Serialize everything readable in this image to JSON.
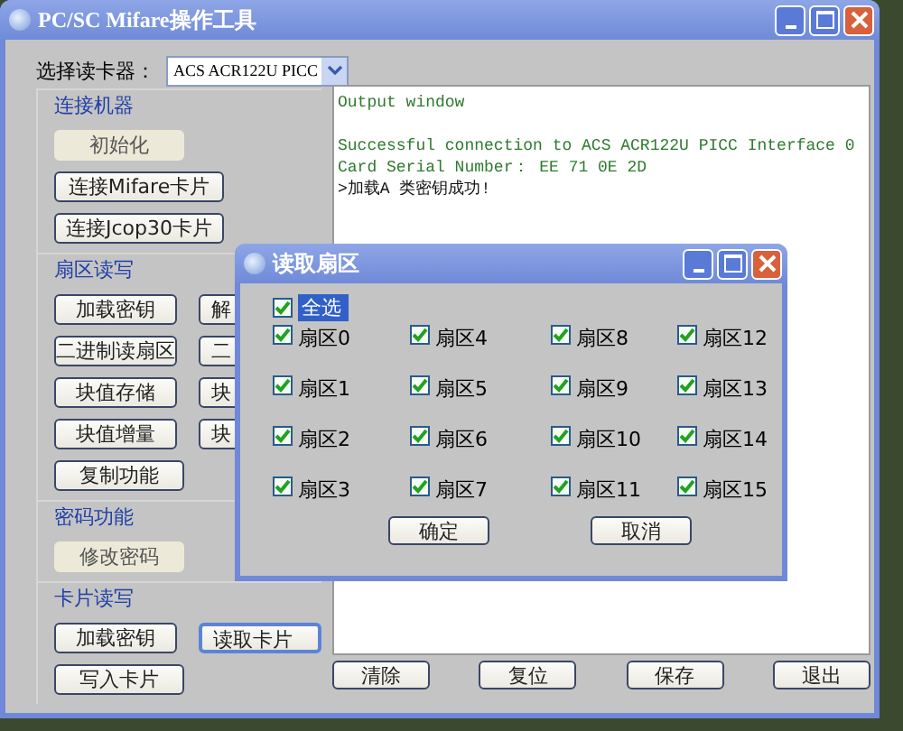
{
  "window": {
    "title": "PC/SC Mifare操作工具"
  },
  "reader": {
    "label": "选择读卡器：",
    "value": "ACS ACR122U PICC"
  },
  "groups": [
    {
      "title": "连接机器",
      "rows": [
        [
          {
            "label": "初始化",
            "disabled": true,
            "focused": false
          }
        ],
        [
          {
            "label": "连接Mifare卡片",
            "disabled": false,
            "focused": false
          }
        ],
        [
          {
            "label": "连接Jcop30卡片",
            "disabled": false,
            "focused": false
          }
        ]
      ]
    },
    {
      "title": "扇区读写",
      "rows": [
        [
          {
            "label": "加载密钥",
            "disabled": false,
            "focused": false
          },
          {
            "label": "解",
            "disabled": false,
            "focused": false
          }
        ],
        [
          {
            "label": "二进制读扇区",
            "disabled": false,
            "focused": false
          },
          {
            "label": "二",
            "disabled": false,
            "focused": false
          }
        ],
        [
          {
            "label": "块值存储",
            "disabled": false,
            "focused": false
          },
          {
            "label": "块",
            "disabled": false,
            "focused": false
          }
        ],
        [
          {
            "label": "块值增量",
            "disabled": false,
            "focused": false
          },
          {
            "label": "块",
            "disabled": false,
            "focused": false
          }
        ],
        [
          {
            "label": "复制功能",
            "disabled": false,
            "focused": false
          }
        ]
      ]
    },
    {
      "title": "密码功能",
      "rows": [
        [
          {
            "label": "修改密码",
            "disabled": true,
            "focused": false
          }
        ]
      ]
    },
    {
      "title": "卡片读写",
      "rows": [
        [
          {
            "label": "加载密钥",
            "disabled": false,
            "focused": false
          },
          {
            "label": "读取卡片",
            "disabled": false,
            "focused": true
          }
        ],
        [
          {
            "label": "写入卡片",
            "disabled": false,
            "focused": false
          }
        ]
      ]
    }
  ],
  "output": {
    "blocks": [
      [
        {
          "text": "Output window",
          "kind": "info"
        }
      ],
      [
        {
          "text": "Successful connection to ACS ACR122U PICC Interface 0",
          "kind": "info"
        },
        {
          "text": "Card Serial Number： EE 71 0E 2D",
          "kind": "info"
        },
        {
          "text": ">加载A 类密钥成功!",
          "kind": "message"
        }
      ]
    ]
  },
  "bottom_buttons": [
    "清除",
    "复位",
    "保存",
    "退出"
  ],
  "dialog": {
    "title": "读取扇区",
    "select_all": {
      "label": "全选",
      "checked": true,
      "selected": true
    },
    "sectors": [
      {
        "label": "扇区0",
        "checked": true
      },
      {
        "label": "扇区1",
        "checked": true
      },
      {
        "label": "扇区2",
        "checked": true
      },
      {
        "label": "扇区3",
        "checked": true
      },
      {
        "label": "扇区4",
        "checked": true
      },
      {
        "label": "扇区5",
        "checked": true
      },
      {
        "label": "扇区6",
        "checked": true
      },
      {
        "label": "扇区7",
        "checked": true
      },
      {
        "label": "扇区8",
        "checked": true
      },
      {
        "label": "扇区9",
        "checked": true
      },
      {
        "label": "扇区10",
        "checked": true
      },
      {
        "label": "扇区11",
        "checked": true
      },
      {
        "label": "扇区12",
        "checked": true
      },
      {
        "label": "扇区13",
        "checked": true
      },
      {
        "label": "扇区14",
        "checked": true
      },
      {
        "label": "扇区15",
        "checked": true
      }
    ],
    "buttons": [
      "确定",
      "取消"
    ]
  }
}
